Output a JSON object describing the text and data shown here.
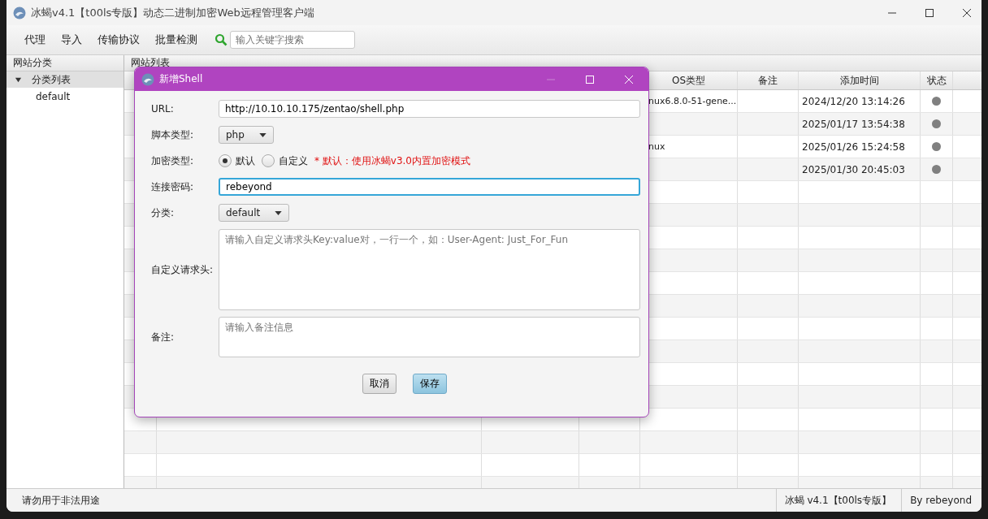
{
  "window": {
    "title": "冰蝎v4.1【t00ls专版】动态二进制加密Web远程管理客户端"
  },
  "toolbar": {
    "menus": [
      "代理",
      "导入",
      "传输协议",
      "批量检测"
    ],
    "search": {
      "placeholder": "输入关键字搜索"
    }
  },
  "sidebar": {
    "title": "网站分类",
    "tree": [
      {
        "label": "分类列表",
        "expanded": true,
        "children": [
          {
            "label": "default"
          }
        ]
      }
    ]
  },
  "main": {
    "title": "网站列表",
    "table": {
      "columns": [
        "OS类型",
        "备注",
        "添加时间",
        "状态"
      ],
      "rows": [
        {
          "os": "nux6.8.0-51-gene...",
          "time": "2024/12/20 13:14:26",
          "color": "#808080"
        },
        {
          "time": "2025/01/17 13:54:38",
          "color": "#808080"
        },
        {
          "os": "nux",
          "time": "2025/01/26 15:24:58",
          "color": "#808080"
        },
        {
          "time": "2025/01/30 20:45:03",
          "color": "#808080"
        }
      ]
    }
  },
  "dialog": {
    "title": "新增Shell",
    "fields": [
      {
        "kind": "text",
        "label": "URL:",
        "value": "http://10.10.10.175/zentao/shell.php",
        "focused": false
      },
      {
        "kind": "select",
        "label": "脚本类型:",
        "value": "php"
      },
      {
        "kind": "radio",
        "label": "加密类型:",
        "options": [
          {
            "label": "默认",
            "selected": true
          },
          {
            "label": "自定义",
            "selected": false
          }
        ],
        "hint": "* 默认：使用冰蝎v3.0内置加密模式"
      },
      {
        "kind": "text",
        "label": "连接密码:",
        "value": "rebeyond",
        "focused": true
      },
      {
        "kind": "select",
        "label": "分类:",
        "value": "default"
      },
      {
        "kind": "textarea",
        "label": "自定义请求头:",
        "placeholder": "请输入自定义请求头Key:value对，一行一个，如：User-Agent: Just_For_Fun",
        "tall": true
      },
      {
        "kind": "textarea",
        "label": "备注:",
        "placeholder": "请输入备注信息",
        "tall": false
      }
    ],
    "buttons": [
      {
        "label": "取消",
        "primary": false
      },
      {
        "label": "保存",
        "primary": true
      }
    ]
  },
  "status_bar": {
    "message": "请勿用于非法用途",
    "version": "冰蝎 v4.1【t00ls专版】",
    "author": "By rebeyond"
  }
}
